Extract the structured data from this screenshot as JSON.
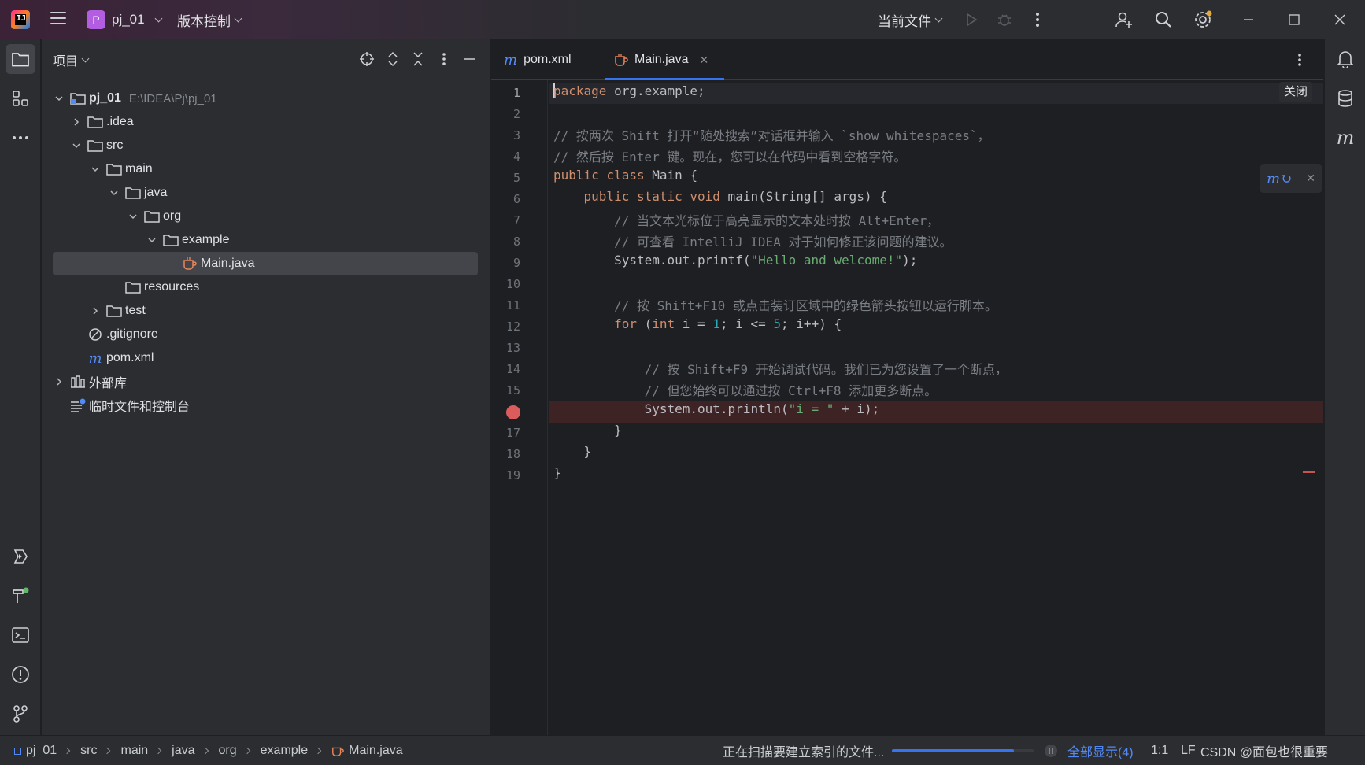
{
  "titlebar": {
    "project_badge": "P",
    "project_name": "pj_01",
    "vcs_label": "版本控制",
    "run_config": "当前文件"
  },
  "project_panel": {
    "title": "项目",
    "tree": [
      {
        "label": "pj_01",
        "path": "E:\\IDEA\\Pj\\pj_01",
        "icon": "module-folder-icon",
        "expanded": true
      },
      {
        "label": ".idea",
        "icon": "folder-icon",
        "expanded": false
      },
      {
        "label": "src",
        "icon": "folder-icon",
        "expanded": true
      },
      {
        "label": "main",
        "icon": "folder-icon",
        "expanded": true
      },
      {
        "label": "java",
        "icon": "folder-icon",
        "expanded": true
      },
      {
        "label": "org",
        "icon": "folder-icon",
        "expanded": true
      },
      {
        "label": "example",
        "icon": "folder-icon",
        "expanded": true
      },
      {
        "label": "Main.java",
        "icon": "java-file-icon",
        "selected": true
      },
      {
        "label": "resources",
        "icon": "folder-icon"
      },
      {
        "label": "test",
        "icon": "folder-icon",
        "expanded": false
      },
      {
        "label": ".gitignore",
        "icon": "ignore-file-icon"
      },
      {
        "label": "pom.xml",
        "icon": "maven-icon"
      },
      {
        "label": "外部库",
        "icon": "library-icon",
        "expanded": false
      },
      {
        "label": "临时文件和控制台",
        "icon": "scratches-icon"
      }
    ]
  },
  "editor": {
    "tabs": [
      {
        "label": "pom.xml",
        "icon": "maven-icon",
        "active": false
      },
      {
        "label": "Main.java",
        "icon": "java-file-icon",
        "active": true
      }
    ],
    "close_hint": "关闭",
    "line_numbers": [
      "1",
      "2",
      "3",
      "4",
      "5",
      "6",
      "7",
      "8",
      "9",
      "10",
      "11",
      "12",
      "13",
      "14",
      "15",
      "17",
      "18",
      "19"
    ],
    "breakpoint_line": 16,
    "code": {
      "l1_kw": "package",
      "l1_rest": " org.example;",
      "l3": "// 按两次 Shift 打开“随处搜索”对话框并输入 `show whitespaces`，",
      "l4": "// 然后按 Enter 键。现在，您可以在代码中看到空格字符。",
      "l5_kw": "public class",
      "l5_rest": " Main {",
      "l6_kw": "public static void",
      "l6_rest": " main(String[] args) {",
      "l7": "// 当文本光标位于高亮显示的文本处时按 Alt+Enter，",
      "l8": "// 可查看 IntelliJ IDEA 对于如何修正该问题的建议。",
      "l9_pre": "System.out.printf(",
      "l9_str": "\"Hello and welcome!\"",
      "l9_post": ");",
      "l11": "// 按 Shift+F10 或点击装订区域中的绿色箭头按钮以运行脚本。",
      "l12_kw": "for",
      "l12_a": " (",
      "l12_kw2": "int",
      "l12_b": " i = ",
      "l12_n1": "1",
      "l12_c": "; i <= ",
      "l12_n2": "5",
      "l12_d": "; i++) {",
      "l14": "// 按 Shift+F9 开始调试代码。我们已为您设置了一个断点，",
      "l15": "// 但您始终可以通过按 Ctrl+F8 添加更多断点。",
      "l16_pre": "System.out.println(",
      "l16_str": "\"i = \"",
      "l16_post": " + i);",
      "l17": "}",
      "l18": "}",
      "l19": "}"
    }
  },
  "statusbar": {
    "breadcrumbs": [
      "pj_01",
      "src",
      "main",
      "java",
      "org",
      "example",
      "Main.java"
    ],
    "indexing_text": "正在扫描要建立索引的文件...",
    "indexing_progress": 0.86,
    "show_all": "全部显示(4)",
    "position": "1:1",
    "line_sep": "LF",
    "watermark": "CSDN @面包也很重要"
  },
  "colors": {
    "accent": "#3574f0",
    "breakpoint": "#db5c5c",
    "keyword": "#cf8e6d",
    "string": "#6aab73",
    "number": "#2aacb8",
    "comment": "#7a7e85"
  }
}
